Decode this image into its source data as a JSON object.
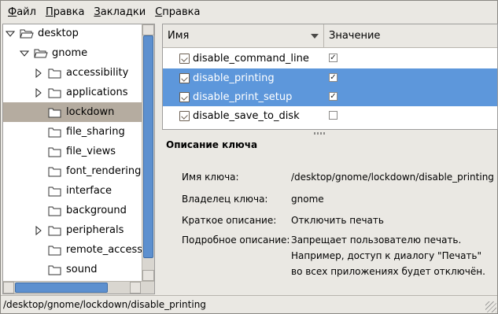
{
  "menubar": {
    "items": [
      {
        "label_first": "Ф",
        "label_rest": "айл"
      },
      {
        "label_first": "П",
        "label_rest": "равка"
      },
      {
        "label_first": "З",
        "label_rest": "акладки"
      },
      {
        "label_first": "С",
        "label_rest": "правка"
      }
    ]
  },
  "tree": {
    "items": [
      {
        "label": "desktop",
        "indent": 0,
        "expander": "expanded",
        "icon": "folder-open-icon"
      },
      {
        "label": "gnome",
        "indent": 1,
        "expander": "expanded",
        "icon": "folder-open-icon"
      },
      {
        "label": "accessibility",
        "indent": 2,
        "expander": "collapsed",
        "icon": "folder-icon"
      },
      {
        "label": "applications",
        "indent": 2,
        "expander": "collapsed",
        "icon": "folder-icon"
      },
      {
        "label": "lockdown",
        "indent": 2,
        "expander": "none",
        "icon": "folder-icon",
        "selected": true
      },
      {
        "label": "file_sharing",
        "indent": 2,
        "expander": "none",
        "icon": "folder-icon"
      },
      {
        "label": "file_views",
        "indent": 2,
        "expander": "none",
        "icon": "folder-icon"
      },
      {
        "label": "font_rendering",
        "indent": 2,
        "expander": "none",
        "icon": "folder-icon"
      },
      {
        "label": "interface",
        "indent": 2,
        "expander": "none",
        "icon": "folder-icon"
      },
      {
        "label": "background",
        "indent": 2,
        "expander": "none",
        "icon": "folder-icon"
      },
      {
        "label": "peripherals",
        "indent": 2,
        "expander": "collapsed",
        "icon": "folder-icon"
      },
      {
        "label": "remote_access",
        "indent": 2,
        "expander": "none",
        "icon": "folder-icon"
      },
      {
        "label": "sound",
        "indent": 2,
        "expander": "none",
        "icon": "folder-icon"
      }
    ]
  },
  "keys": {
    "col_name": "Имя",
    "col_value": "Значение",
    "rows": [
      {
        "name": "disable_command_line",
        "checked": true,
        "selected": false
      },
      {
        "name": "disable_printing",
        "checked": true,
        "selected": true
      },
      {
        "name": "disable_print_setup",
        "checked": true,
        "selected": true
      },
      {
        "name": "disable_save_to_disk",
        "checked": false,
        "selected": false
      }
    ]
  },
  "description": {
    "title": "Описание ключа",
    "key_name_label": "Имя ключа:",
    "key_name_value": "/desktop/gnome/lockdown/disable_printing",
    "owner_label": "Владелец ключа:",
    "owner_value": "gnome",
    "short_label": "Краткое описание:",
    "short_value": "Отключить печать",
    "long_label": "Подробное описание:",
    "long_value_lines": [
      "Запрещает пользователю печать.",
      "Например, доступ к диалогу \"Печать\"",
      "во всех приложениях будет отключён."
    ]
  },
  "statusbar": {
    "path": "/desktop/gnome/lockdown/disable_printing"
  },
  "colors": {
    "selection_blue": "#5d97db",
    "tree_selection": "#b5aca0",
    "window_bg": "#eae8e3"
  }
}
